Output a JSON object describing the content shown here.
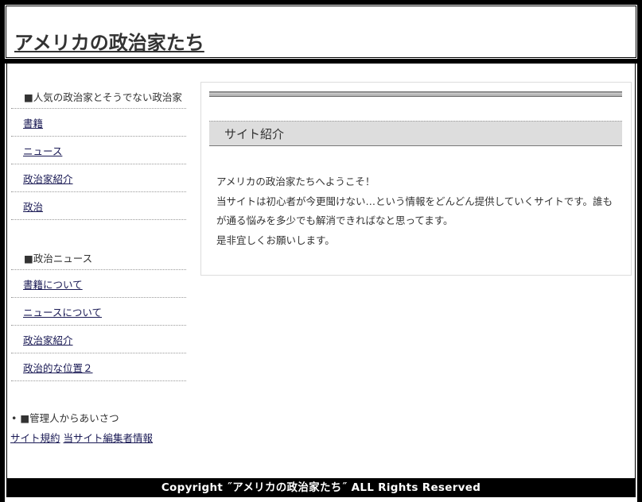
{
  "header": {
    "title": "アメリカの政治家たち"
  },
  "sidebar": {
    "sections": [
      {
        "heading": "■人気の政治家とそうでない政治家",
        "items": [
          {
            "label": "書籍"
          },
          {
            "label": "ニュース"
          },
          {
            "label": "政治家紹介"
          },
          {
            "label": "政治"
          }
        ]
      },
      {
        "heading": "■政治ニュース",
        "items": [
          {
            "label": "書籍について"
          },
          {
            "label": "ニュースについて"
          },
          {
            "label": "政治家紹介"
          },
          {
            "label": "政治的な位置２"
          }
        ]
      }
    ],
    "admin": {
      "bullet": "•",
      "heading": "■管理人からあいさつ",
      "links": [
        {
          "label": "サイト規約"
        },
        {
          "label": "当サイト編集者情報"
        }
      ]
    }
  },
  "main": {
    "section_title": "サイト紹介",
    "intro_lines": [
      "アメリカの政治家たちへようこそ！",
      "当サイトは初心者が今更聞けない…という情報をどんどん提供していくサイトです。誰もが通る悩みを多少でも解消できればなと思ってます。",
      "是非宜しくお願いします。"
    ]
  },
  "footer": {
    "copyright": "Copyright ˝アメリカの政治家たち˝ ALL Rights Reserved"
  }
}
